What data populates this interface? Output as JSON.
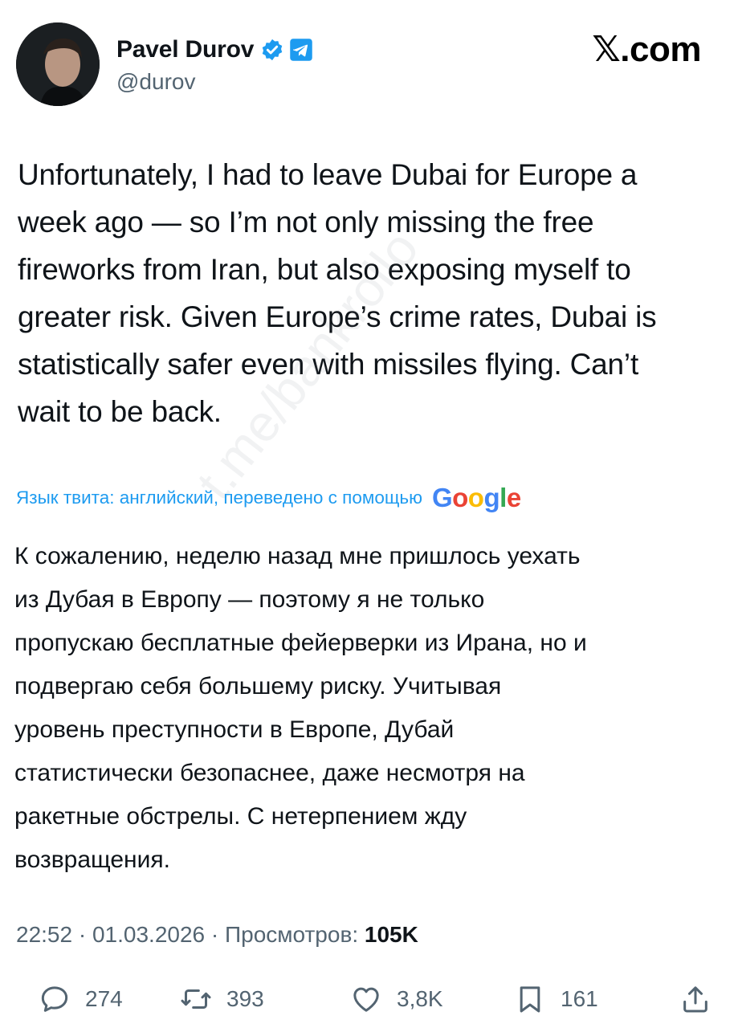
{
  "author": {
    "name": "Pavel Durov",
    "handle": "@durov"
  },
  "brand": "𝕏.com",
  "tweet": {
    "text_lines": [
      "Unfortunately, I had to leave Dubai for Europe a",
      "week ago — so I’m not only missing the free",
      "fireworks from Iran, but also exposing myself to",
      "greater risk. Given Europe’s crime rates, Dubai is",
      "statistically safer even with missiles flying. Can’t",
      "wait to be back."
    ]
  },
  "translation": {
    "label": "Язык твита: английский, переведено с помощью",
    "provider": "Google",
    "text_lines": [
      "К сожалению, неделю назад мне пришлось уехать",
      "из Дубая в Европу — поэтому я не только",
      "пропускаю бесплатные фейерверки из Ирана, но и",
      "подвергаю себя большему риску. Учитывая",
      "уровень преступности в Европе, Дубай",
      "статистически безопаснее, даже несмотря на",
      "ракетные обстрелы. С нетерпением жду",
      "возвращения."
    ]
  },
  "watermark": "t.me/bankrollo",
  "meta": {
    "time": "22:52",
    "date": "01.03.2026",
    "views_label": "Просмотров:",
    "views_count": "105K",
    "separator": "·"
  },
  "actions": {
    "replies": "274",
    "reposts": "393",
    "likes": "3,8K",
    "bookmarks": "161"
  },
  "icons": {
    "verified": "verified-badge-icon",
    "telegram": "telegram-icon",
    "reply": "reply-icon",
    "repost": "repost-icon",
    "like": "heart-icon",
    "bookmark": "bookmark-icon",
    "share": "share-icon"
  },
  "colors": {
    "accent": "#1d9bf0",
    "secondary_text": "#536471",
    "primary_text": "#0f1419",
    "google_blue": "#4285F4",
    "google_red": "#EA4335",
    "google_yellow": "#FBBC05",
    "google_green": "#34A853"
  }
}
